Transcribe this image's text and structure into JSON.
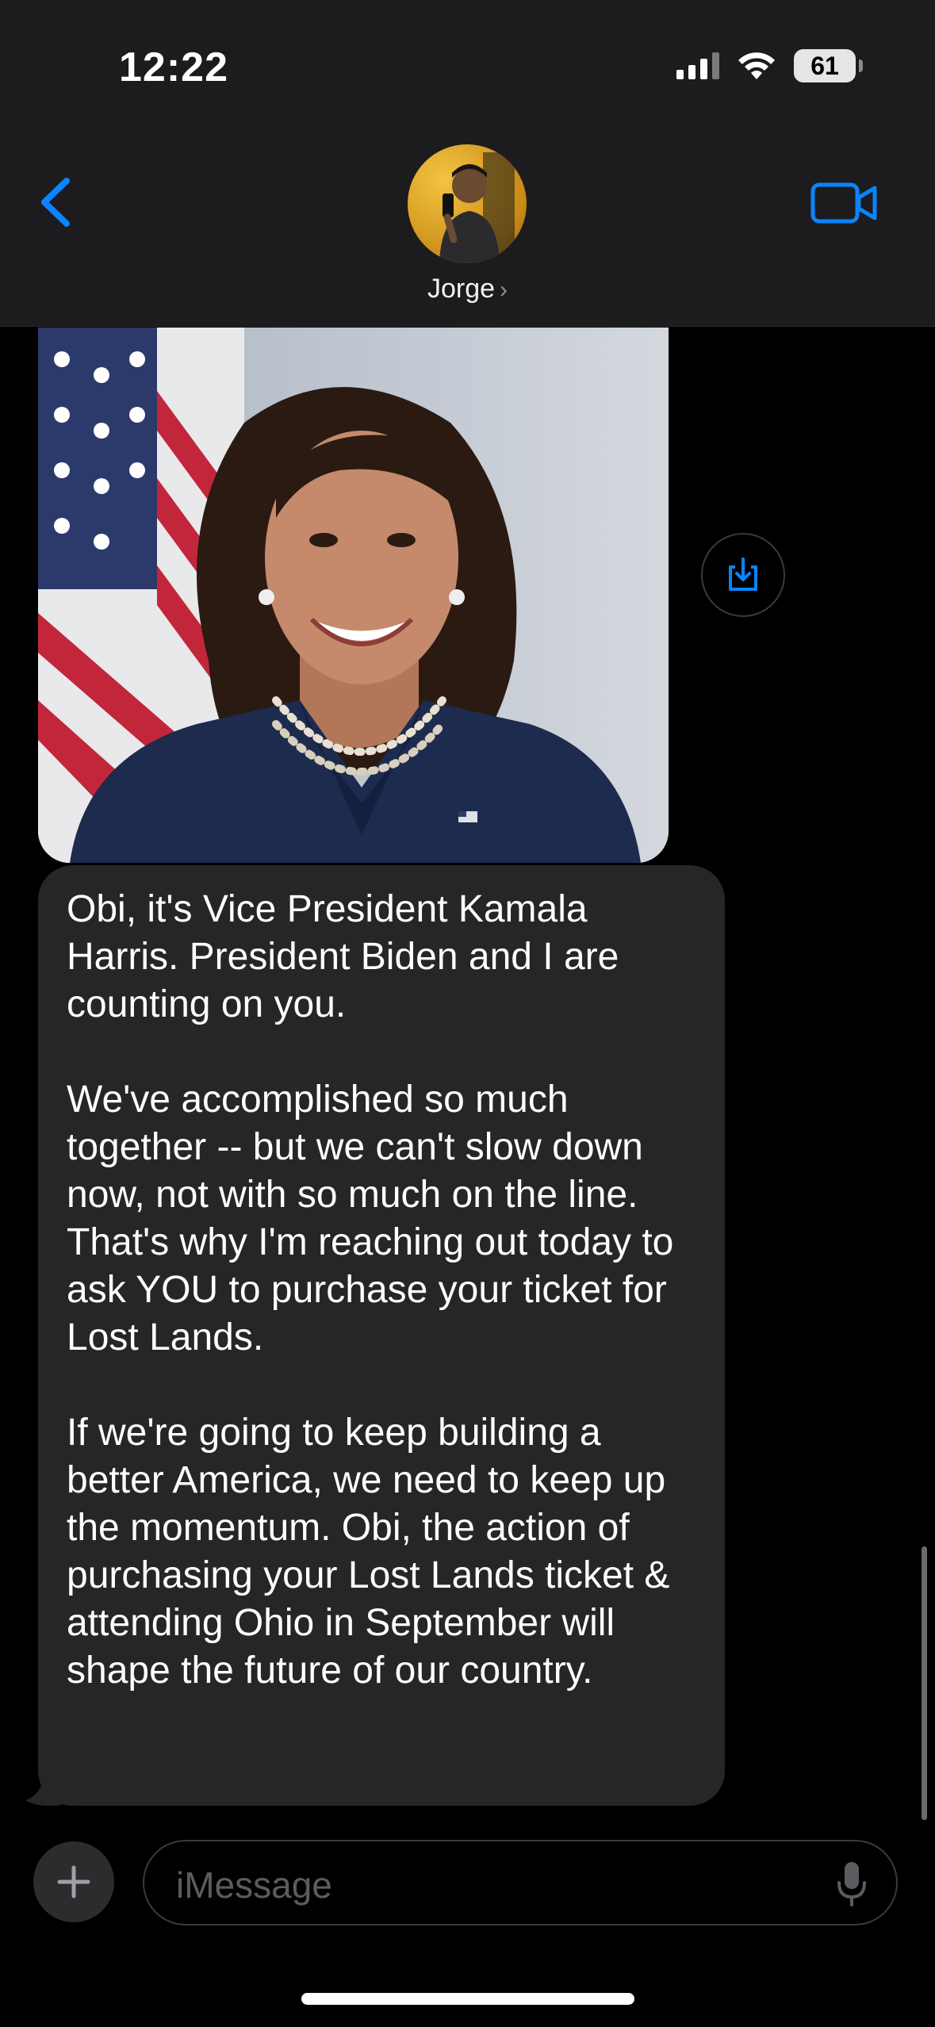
{
  "status_bar": {
    "time": "12:22",
    "battery": "61",
    "icons": [
      "cellular-signal-icon",
      "wifi-icon",
      "battery-icon"
    ]
  },
  "header": {
    "contact_name": "Jorge",
    "chevron": "›",
    "icons": [
      "back-chevron-icon",
      "video-call-icon"
    ]
  },
  "message_image": {
    "description_icon": "portrait-photo",
    "save_icon": "save-download-icon"
  },
  "message": {
    "paragraphs": [
      "Obi, it's Vice President Kamala Harris. President Biden and I are counting on you.",
      "",
      "We've accomplished so much together -- but we can't slow down now, not with so much on the line.",
      "That's why I'm reaching out today to ask YOU to purchase your ticket for Lost Lands.",
      "",
      "If we're going to keep building a better America, we need to keep up the momentum. Obi, the action of purchasing your Lost Lands ticket & attending Ohio in September will shape the future of our country."
    ]
  },
  "composer": {
    "placeholder": "iMessage",
    "icons": [
      "plus-icon",
      "microphone-icon"
    ]
  },
  "colors": {
    "accent": "#0a84ff",
    "bubble_incoming": "#262628",
    "header_bg": "#1c1c1e"
  }
}
